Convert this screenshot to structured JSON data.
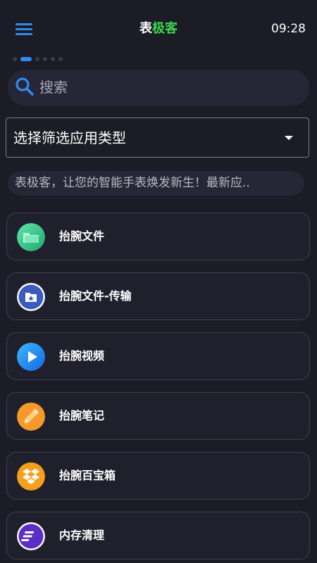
{
  "topbar": {
    "title_part1": "表",
    "title_part2": "极客",
    "time": "09:28",
    "menu_icon": "hamburger-menu-icon",
    "accent": "#2f8bf0",
    "title_highlight": "#36d94a"
  },
  "pager": {
    "count": 6,
    "active_index": 1
  },
  "search": {
    "placeholder": "搜索",
    "icon": "search-icon"
  },
  "filter": {
    "label": "选择筛选应用类型",
    "icon": "dropdown-caret-icon"
  },
  "notice": {
    "text": "表极客，让您的智能手表焕发新生！最新应.."
  },
  "apps": [
    {
      "name": "抬腕文件",
      "icon": "folder-icon",
      "color": "#2ec58a"
    },
    {
      "name": "抬腕文件-传输",
      "icon": "star-folder-icon",
      "color": "#3b5bbd"
    },
    {
      "name": "抬腕视频",
      "icon": "play-icon",
      "color": "#1e8cf0"
    },
    {
      "name": "抬腕笔记",
      "icon": "pencil-icon",
      "color": "#f59a2a"
    },
    {
      "name": "抬腕百宝箱",
      "icon": "dropbox-icon",
      "color": "#f5a01a"
    },
    {
      "name": "内存清理",
      "icon": "cleanup-icon",
      "color": "#5b2fc4"
    }
  ]
}
